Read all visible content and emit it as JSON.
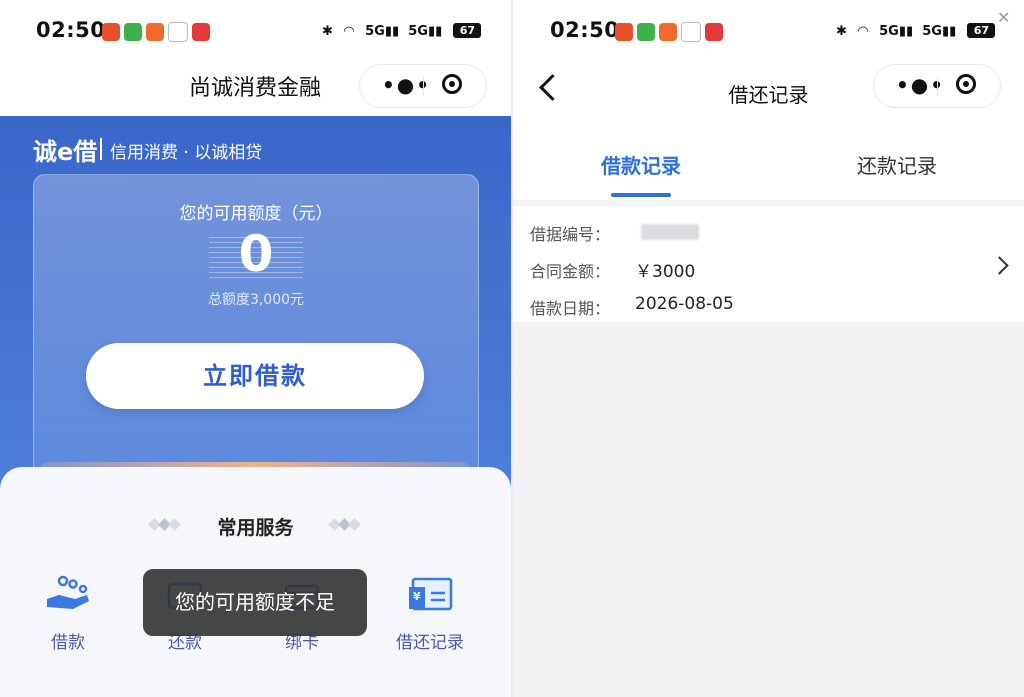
{
  "left": {
    "status": {
      "time": "02:50",
      "battery": "67",
      "net1": "5G",
      "net2": "5G"
    },
    "nav": {
      "title": "尚诚消费金融"
    },
    "brand": {
      "name": "诚e借",
      "slogan": "信用消费 · 以诚相贷"
    },
    "credit": {
      "label": "您的可用额度（元）",
      "value": "0",
      "total": "总额度3,000元"
    },
    "borrow_button": "立即借款",
    "services": {
      "title": "常用服务",
      "items": [
        {
          "label": "借款",
          "icon": "borrow-hand-icon"
        },
        {
          "label": "还款",
          "icon": "repay-icon"
        },
        {
          "label": "绑卡",
          "icon": "bind-card-icon"
        },
        {
          "label": "借还记录",
          "icon": "records-icon"
        }
      ]
    },
    "toast": "您的可用额度不足"
  },
  "right": {
    "status": {
      "time": "02:50",
      "battery": "67",
      "net1": "5G",
      "net2": "5G"
    },
    "nav": {
      "title": "借还记录"
    },
    "tabs": [
      {
        "label": "借款记录",
        "active": true
      },
      {
        "label": "还款记录",
        "active": false
      }
    ],
    "record": {
      "fields": [
        {
          "label": "借据编号：",
          "value": ""
        },
        {
          "label": "合同金额：",
          "value": "￥3000"
        },
        {
          "label": "借款日期：",
          "value": "2026-08-05"
        }
      ]
    }
  },
  "colors": {
    "primary_blue": "#2f6fd6",
    "header_blue": "#3a66c9",
    "toast_bg": "#323232"
  }
}
